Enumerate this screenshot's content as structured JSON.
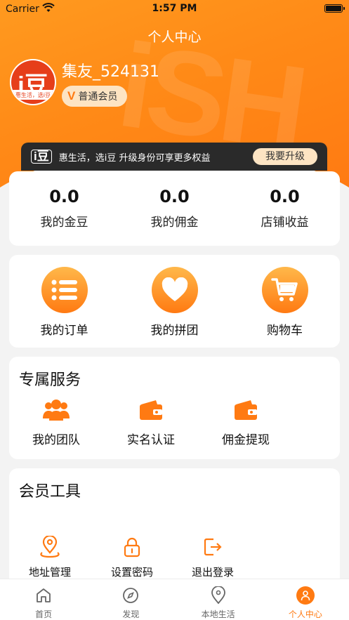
{
  "status_bar": {
    "carrier": "Carrier",
    "time": "1:57 PM"
  },
  "header": {
    "title": "个人中心"
  },
  "profile": {
    "avatar_text": "i豆",
    "avatar_subtext": "惠生活，选i豆",
    "username": "集友_524131",
    "member_badge_icon": "V",
    "member_level": "普通会员"
  },
  "upgrade_banner": {
    "logo": "i豆",
    "text": "惠生活，选i豆 升级身份可享更多权益",
    "button": "我要升级"
  },
  "stats": [
    {
      "value": "0.0",
      "label": "我的金豆"
    },
    {
      "value": "0.0",
      "label": "我的佣金"
    },
    {
      "value": "0.0",
      "label": "店铺收益"
    }
  ],
  "orders": [
    {
      "icon": "list-icon",
      "label": "我的订单"
    },
    {
      "icon": "heart-icon",
      "label": "我的拼团"
    },
    {
      "icon": "cart-icon",
      "label": "购物车"
    }
  ],
  "services": {
    "title": "专属服务",
    "items": [
      {
        "icon": "team-icon",
        "label": "我的团队"
      },
      {
        "icon": "wallet-icon",
        "label": "实名认证"
      },
      {
        "icon": "wallet-icon",
        "label": "佣金提现"
      }
    ]
  },
  "tools": {
    "title": "会员工具",
    "items": [
      {
        "icon": "location-icon",
        "label": "地址管理"
      },
      {
        "icon": "lock-icon",
        "label": "设置密码"
      },
      {
        "icon": "logout-icon",
        "label": "退出登录"
      }
    ]
  },
  "tabbar": [
    {
      "icon": "home-icon",
      "label": "首页",
      "active": false
    },
    {
      "icon": "compass-icon",
      "label": "发现",
      "active": false
    },
    {
      "icon": "map-pin-icon",
      "label": "本地生活",
      "active": false
    },
    {
      "icon": "user-icon",
      "label": "个人中心",
      "active": true
    }
  ],
  "colors": {
    "accent": "#ff7a12",
    "badge_bg": "#fde4c3",
    "banner_bg": "#2a2a2a"
  }
}
